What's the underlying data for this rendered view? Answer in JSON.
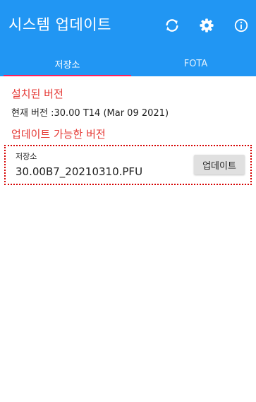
{
  "header": {
    "title": "시스템 업데이트",
    "icons": [
      "refresh-icon",
      "gear-icon",
      "info-icon"
    ]
  },
  "tabs": [
    {
      "label": "저장소",
      "selected": true
    },
    {
      "label": "FOTA",
      "selected": false
    }
  ],
  "installed": {
    "title": "설치된 버전",
    "current_version": "현재 버전 :30.00 T14 (Mar 09 2021)"
  },
  "available": {
    "title": "업데이트 가능한 버전",
    "items": [
      {
        "source": "저장소",
        "file": "30.00B7_20210310.PFU",
        "button_label": "업데이트"
      }
    ]
  },
  "colors": {
    "primary": "#2196f3",
    "tab_indicator": "#ff1f5e",
    "section_title": "#e53935",
    "highlight_border": "#d60000"
  }
}
